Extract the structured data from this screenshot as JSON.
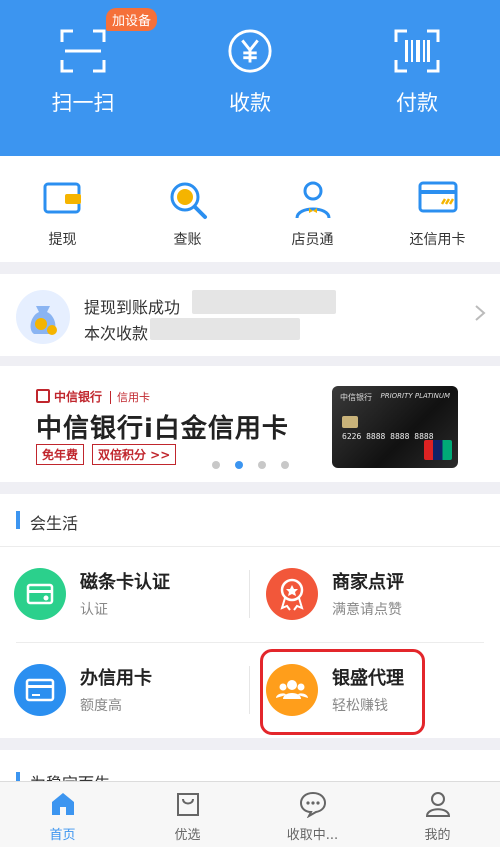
{
  "header": {
    "badge": "加设备",
    "items": [
      {
        "label": "扫一扫",
        "icon": "scan-icon"
      },
      {
        "label": "收款",
        "icon": "yuan-icon"
      },
      {
        "label": "付款",
        "icon": "barcode-icon"
      }
    ]
  },
  "quick": {
    "items": [
      {
        "label": "提现",
        "icon": "wallet-icon"
      },
      {
        "label": "查账",
        "icon": "search-yuan-icon"
      },
      {
        "label": "店员通",
        "icon": "clerk-icon"
      },
      {
        "label": "还信用卡",
        "icon": "credit-card-icon"
      }
    ]
  },
  "notice": {
    "line1": "提现到账成功",
    "line2": "本次收款"
  },
  "banner": {
    "bank": "中信银行",
    "card_label": "信用卡",
    "title": "中信银行i白金信用卡",
    "tags": [
      "免年费",
      "双倍积分 >>"
    ],
    "card_text": "PRIORITY PLATINUM",
    "card_number": "6226 8888 8888 8888",
    "active_dot": 1
  },
  "life": {
    "title": "会生活",
    "items": [
      {
        "title": "磁条卡认证",
        "subtitle": "认证",
        "color": "#2bd08c"
      },
      {
        "title": "商家点评",
        "subtitle": "满意请点赞",
        "color": "#f2573a"
      },
      {
        "title": "办信用卡",
        "subtitle": "额度高",
        "color": "#2b8ff0"
      },
      {
        "title": "银盛代理",
        "subtitle": "轻松赚钱",
        "color": "#ff9e1b"
      }
    ]
  },
  "next_section": {
    "title": "为稳定而生"
  },
  "tabbar": {
    "items": [
      {
        "label": "首页",
        "icon": "home-icon",
        "active": true
      },
      {
        "label": "优选",
        "icon": "shopping-bag-icon"
      },
      {
        "label": "收取中...",
        "icon": "chat-bubble-icon"
      },
      {
        "label": "我的",
        "icon": "user-icon"
      }
    ]
  },
  "colors": {
    "primary": "#3c95f0",
    "highlight": "#e3262b"
  }
}
